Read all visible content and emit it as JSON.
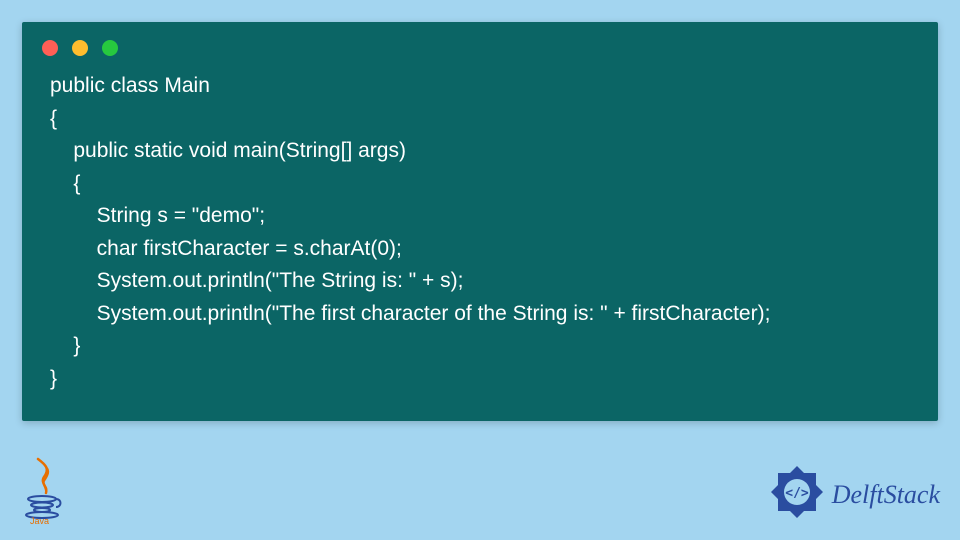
{
  "code": {
    "lines": [
      "public class Main",
      "{",
      "    public static void main(String[] args)",
      "    {",
      "        String s = \"demo\";",
      "        char firstCharacter = s.charAt(0);",
      "        System.out.println(\"The String is: \" + s);",
      "        System.out.println(\"The first character of the String is: \" + firstCharacter);",
      "    }",
      "}"
    ]
  },
  "branding": {
    "delftstack": "DelftStack",
    "java": "Java"
  },
  "colors": {
    "page_bg": "#a3d5f0",
    "window_bg": "#0b6565",
    "code_text": "#ffffff",
    "brand": "#2a4da0",
    "java_red": "#e76f00"
  }
}
